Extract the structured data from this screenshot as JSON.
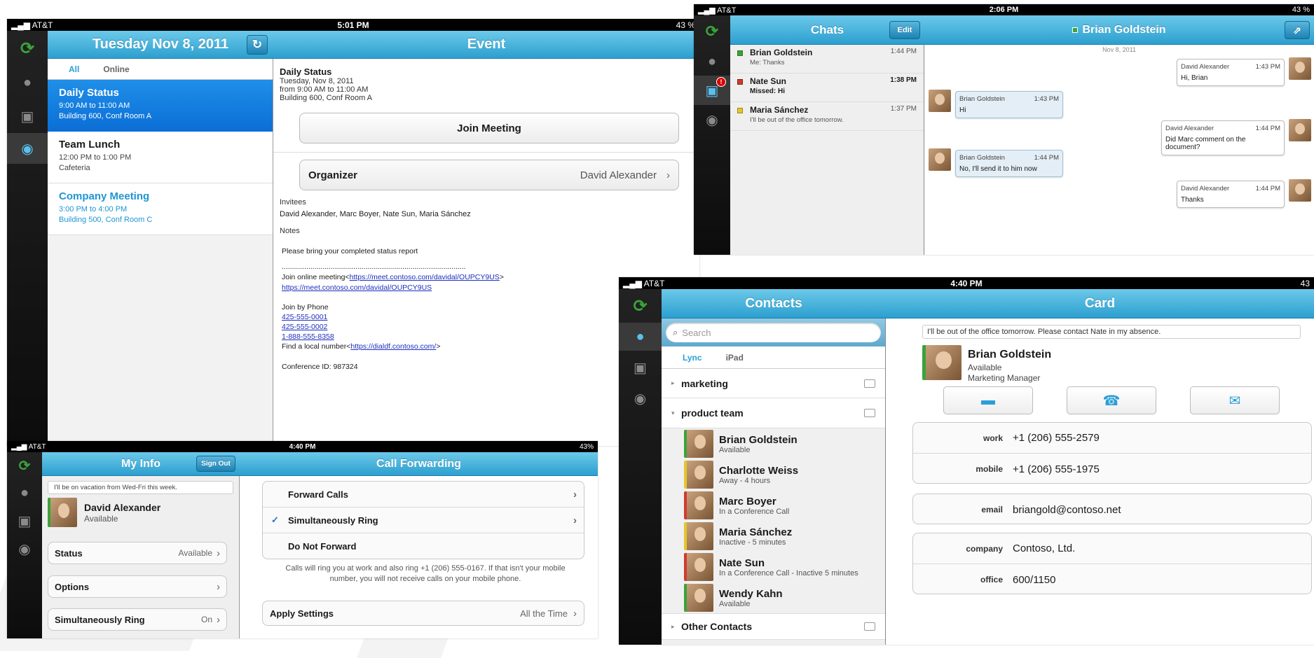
{
  "colors": {
    "accent": "#2a9fd8",
    "nav_blue": "#3aaedc",
    "presence_available": "#3aa33a",
    "presence_away": "#e6c62a",
    "presence_busy": "#d13b2f",
    "link": "#1b2fbd"
  },
  "calendar": {
    "status": {
      "carrier": "AT&T",
      "time": "5:01 PM",
      "battery": "43 %"
    },
    "date_title": "Tuesday Nov 8, 2011",
    "refresh_icon": "refresh-icon",
    "filter_all": "All",
    "filter_online": "Online",
    "events": [
      {
        "title": "Daily Status",
        "time": "9:00 AM to 11:00 AM",
        "location": "Building 600, Conf Room A"
      },
      {
        "title": "Team Lunch",
        "time": "12:00 PM to 1:00 PM",
        "location": "Cafeteria"
      },
      {
        "title": "Company Meeting",
        "time": "3:00 PM to 4:00 PM",
        "location": "Building 500, Conf Room C"
      }
    ],
    "event_title": "Event",
    "detail": {
      "name": "Daily Status",
      "date": "Tuesday, Nov 8, 2011",
      "time": "from 9:00 AM to 11:00 AM",
      "location": "Building 600, Conf Room A",
      "join_button": "Join Meeting",
      "organizer_label": "Organizer",
      "organizer_value": "David Alexander",
      "invitees_label": "Invitees",
      "invitees": "David Alexander, Marc Boyer, Nate Sun, Maria Sánchez",
      "notes_label": "Notes",
      "notes_line": "Please bring your completed status report",
      "dots": "..........................................................................................",
      "join_online_prefix": "Join online meeting<",
      "join_online_url": "https://meet.contoso.com/davidal/OUPCY9US",
      "join_online_suffix": ">",
      "join_online_url2": "https://meet.contoso.com/davidal/OUPCY9US",
      "join_phone_label": "Join by Phone",
      "phones": [
        "425-555-0001",
        "425-555-0002",
        "1-888-555-8358"
      ],
      "local_prefix": "Find a local number<",
      "local_url": "https://dialdf.contoso.com/",
      "local_suffix": ">",
      "conference_id": "Conference ID: 987324"
    }
  },
  "chats": {
    "status": {
      "carrier": "AT&T",
      "time": "2:06 PM",
      "battery": "43 %"
    },
    "title": "Chats",
    "edit": "Edit",
    "badge": "!",
    "items": [
      {
        "name": "Brian Goldstein",
        "preview": "Me: Thanks",
        "time": "1:44 PM"
      },
      {
        "name": "Nate Sun",
        "preview": "Missed: Hi",
        "time": "1:38 PM"
      },
      {
        "name": "Maria Sánchez",
        "preview": "I'll be out of the office tomorrow.",
        "time": "1:37 PM"
      }
    ],
    "conv_title": "Brian Goldstein",
    "date": "Nov 8, 2011",
    "messages": [
      {
        "from": "David Alexander",
        "time": "1:43 PM",
        "text": "Hi, Brian"
      },
      {
        "from": "Brian Goldstein",
        "time": "1:43 PM",
        "text": "Hi"
      },
      {
        "from": "David Alexander",
        "time": "1:44 PM",
        "text": "Did Marc comment on the document?"
      },
      {
        "from": "Brian Goldstein",
        "time": "1:44 PM",
        "text": "No, I'll send it to him now"
      },
      {
        "from": "David Alexander",
        "time": "1:44 PM",
        "text": "Thanks"
      }
    ]
  },
  "myinfo": {
    "status": {
      "carrier": "AT&T",
      "time": "4:40 PM",
      "battery": "43%"
    },
    "title": "My Info",
    "sign_out": "Sign Out",
    "note": "I'll be on vacation from Wed-Fri this week.",
    "name": "David Alexander",
    "presence": "Available",
    "rows": [
      {
        "label": "Status",
        "value": "Available"
      },
      {
        "label": "Options",
        "value": ""
      },
      {
        "label": "Simultaneously Ring",
        "value": "On"
      }
    ],
    "cf_title": "Call Forwarding",
    "cf_options": [
      "Forward Calls",
      "Simultaneously Ring",
      "Do Not Forward"
    ],
    "cf_check": "✓",
    "cf_note": "Calls will ring you at work and also ring +1 (206) 555-0167. If that isn't your mobile number, you will not receive calls on your mobile phone.",
    "apply_label": "Apply Settings",
    "apply_value": "All the Time"
  },
  "contacts": {
    "status": {
      "carrier": "AT&T",
      "time": "4:40 PM",
      "battery": "43"
    },
    "title": "Contacts",
    "search_placeholder": "Search",
    "tab_lync": "Lync",
    "tab_ipad": "iPad",
    "group_marketing": "marketing",
    "group_product": "product team",
    "group_other": "Other Contacts",
    "people": [
      {
        "name": "Brian Goldstein",
        "status": "Available"
      },
      {
        "name": "Charlotte Weiss",
        "status": "Away - 4 hours"
      },
      {
        "name": "Marc Boyer",
        "status": "In a Conference Call"
      },
      {
        "name": "Maria Sánchez",
        "status": "Inactive - 5 minutes"
      },
      {
        "name": "Nate Sun",
        "status": "In a Conference Call - Inactive 5 minutes"
      },
      {
        "name": "Wendy Kahn",
        "status": "Available"
      }
    ],
    "card_title": "Card",
    "card_note": "I'll be out of the office tomorrow. Please contact Nate in my absence.",
    "card_name": "Brian Goldstein",
    "card_presence": "Available",
    "card_job": "Marketing Manager",
    "fields": {
      "work_label": "work",
      "work": "+1 (206) 555-2579",
      "mobile_label": "mobile",
      "mobile": "+1 (206) 555-1975",
      "email_label": "email",
      "email": "briangold@contoso.net",
      "company_label": "company",
      "company": "Contoso, Ltd.",
      "office_label": "office",
      "office": "600/1150"
    }
  }
}
